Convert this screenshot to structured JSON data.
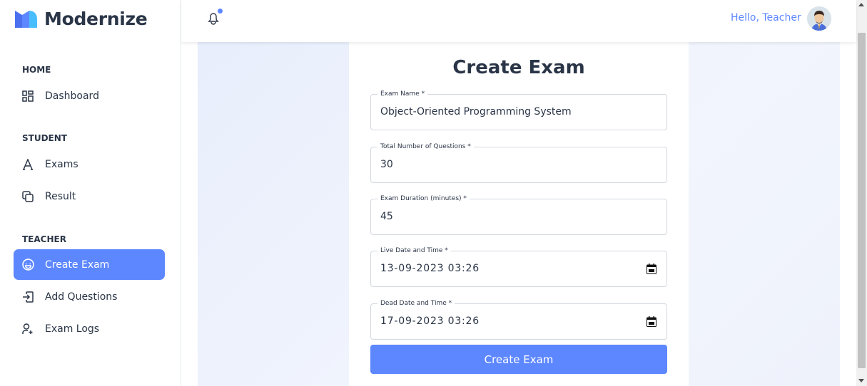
{
  "brand": {
    "name": "Modernize",
    "icon": "modernize-logo-icon"
  },
  "sidebar": {
    "sections": [
      {
        "title": "HOME",
        "items": [
          {
            "label": "Dashboard",
            "icon": "layout-dashboard-icon"
          }
        ]
      },
      {
        "title": "STUDENT",
        "items": [
          {
            "label": "Exams",
            "icon": "typography-icon"
          },
          {
            "label": "Result",
            "icon": "copy-icon"
          }
        ]
      },
      {
        "title": "TEACHER",
        "items": [
          {
            "label": "Create Exam",
            "icon": "mood-happy-icon",
            "active": true
          },
          {
            "label": "Add Questions",
            "icon": "login-icon"
          },
          {
            "label": "Exam Logs",
            "icon": "user-plus-icon"
          }
        ]
      }
    ]
  },
  "header": {
    "greeting": "Hello, Teacher",
    "bell_icon": "bell-icon",
    "avatar_icon": "user-avatar"
  },
  "form": {
    "title": "Create Exam",
    "fields": [
      {
        "label": "Exam Name *",
        "value": "Object-Oriented Programming System"
      },
      {
        "label": "Total Number of Questions *",
        "value": "30"
      },
      {
        "label": "Exam Duration (minutes) *",
        "value": "45"
      },
      {
        "label": "Live Date and Time *",
        "value": "13-09-2023 03:26"
      },
      {
        "label": "Dead Date and Time *",
        "value": "17-09-2023 03:26"
      }
    ],
    "submit_label": "Create Exam"
  },
  "colors": {
    "primary": "#5d87ff",
    "text": "#2a3547",
    "border": "#d3d8e0"
  }
}
